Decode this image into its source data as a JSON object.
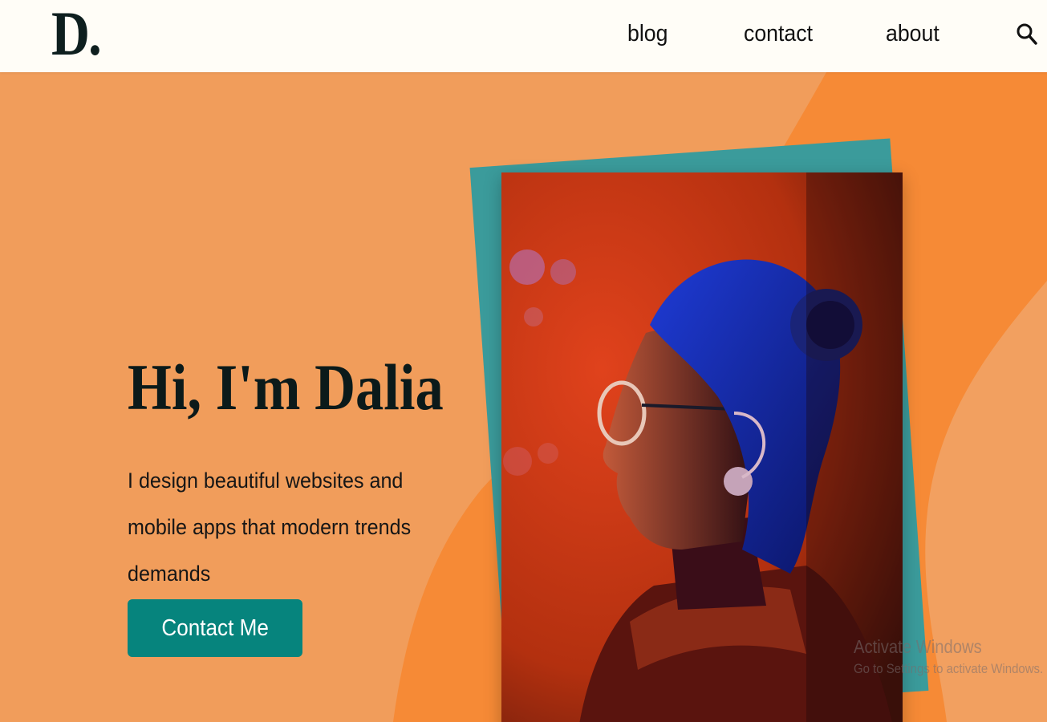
{
  "header": {
    "logo": "D.",
    "nav": [
      "blog",
      "contact",
      "about"
    ],
    "search_icon": "search-icon"
  },
  "hero": {
    "title": "Hi, I'm Dalia",
    "description": "I design beautiful websites and mobile apps that modern trends demands",
    "cta_label": "Contact Me",
    "photo": "portrait-photo"
  },
  "watermark": {
    "title": "Activate Windows",
    "subtitle": "Go to Settings to activate Windows."
  },
  "colors": {
    "background": "#f19d5b",
    "accent_orange": "#f68a36",
    "teal": "#06847d",
    "header_bg": "#fffdf7",
    "text_dark": "#0b1a1a"
  }
}
